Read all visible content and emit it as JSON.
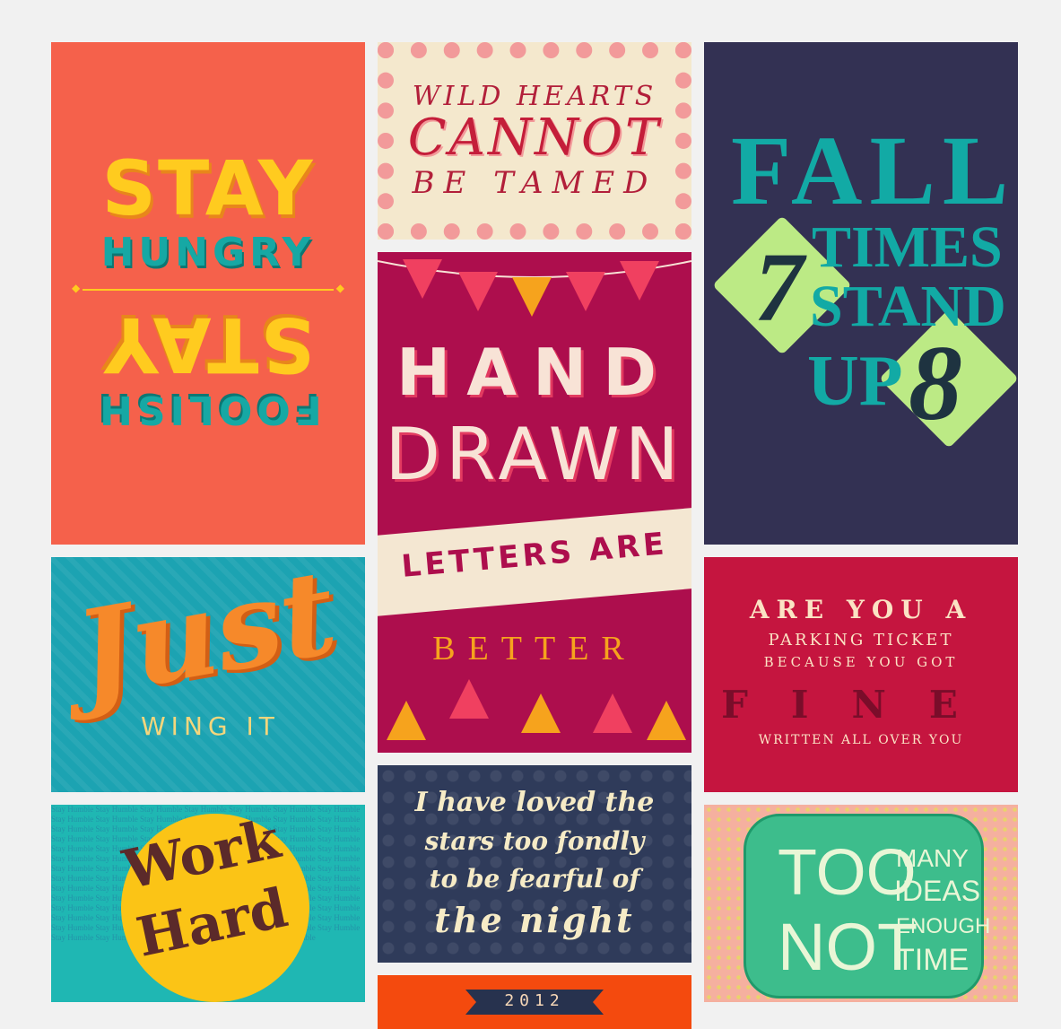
{
  "cards": {
    "stay_hungry": {
      "line1": "STAY",
      "line2": "HUNGRY",
      "line3": "FOOLISH",
      "line4": "STAY",
      "bg_color": "#f5614b"
    },
    "wild_hearts": {
      "line1": "WILD HEARTS",
      "line2": "CANNOT",
      "line3": "BE TAMED",
      "bg_color": "#f4e8cd"
    },
    "fall_seven": {
      "line1": "FALL",
      "num1": "7",
      "line2": "TIMES",
      "line3": "STAND",
      "line4": "UP",
      "num2": "8",
      "bg_color": "#333153"
    },
    "hand_drawn": {
      "line1": "HAND",
      "line2": "DRAWN",
      "line3": "LETTERS ARE",
      "line4": "BETTER",
      "bg_color": "#ad0e4d"
    },
    "just_wing": {
      "line1": "Just",
      "line2": "WING IT",
      "bg_color": "#1ca3b2"
    },
    "parking_ticket": {
      "line1": "ARE YOU A",
      "line2": "PARKING TICKET",
      "line3": "BECAUSE YOU GOT",
      "line4": "FINE",
      "line5": "WRITTEN ALL OVER YOU",
      "bg_color": "#c5153f"
    },
    "work_hard": {
      "background_text": "Stay Humble Stay Humble Stay Humble Stay Humble Stay Humble Stay Humble Stay Humble Stay Humble Stay Humble Stay Humble Stay Humble Stay Humble Stay Humble Stay Humble Stay Humble Stay Humble Stay Humble Stay Humble Stay Humble Stay Humble Stay Humble Stay Humble Stay Humble Stay Humble Stay Humble Stay Humble Stay Humble Stay Humble Stay Humble Stay Humble Stay Humble Stay Humble Stay Humble Stay Humble Stay Humble Stay Humble Stay Humble Stay Humble Stay Humble Stay Humble Stay Humble Stay Humble Stay Humble Stay Humble Stay Humble Stay Humble Stay Humble Stay Humble Stay Humble Stay Humble Stay Humble Stay Humble Stay Humble Stay Humble Stay Humble Stay Humble Stay Humble Stay Humble Stay Humble Stay Humble Stay Humble Stay Humble Stay Humble Stay Humble Stay Humble Stay Humble Stay Humble Stay Humble Stay Humble Stay Humble Stay Humble Stay Humble Stay Humble Stay Humble Stay Humble Stay Humble Stay Humble Stay Humble Stay Humble Stay Humble Stay Humble Stay Humble Stay Humble Stay Humble Stay Humble Stay Humble Stay Humble Stay Humble Stay Humble Stay Humble Stay Humble Stay Humble Stay Humble Stay Humble Stay Humble Stay Humble Stay Humble",
      "line1": "Work",
      "line2": "Hard",
      "bg_color": "#1fb7b3"
    },
    "stars": {
      "line1": "I have loved the",
      "line2": "stars too fondly",
      "line3": "to be fearful of",
      "line4": "the night",
      "bg_color": "#2f3b5a"
    },
    "too_many": {
      "word1": "TOO",
      "word2": "MANY",
      "word3": "IDEAS",
      "word4": "NOT",
      "word5": "ENOUGH",
      "word6": "TIME",
      "bg_color": "#3dbd8c"
    },
    "year_card": {
      "year": "2012",
      "bg_color": "#f44a0e"
    }
  }
}
